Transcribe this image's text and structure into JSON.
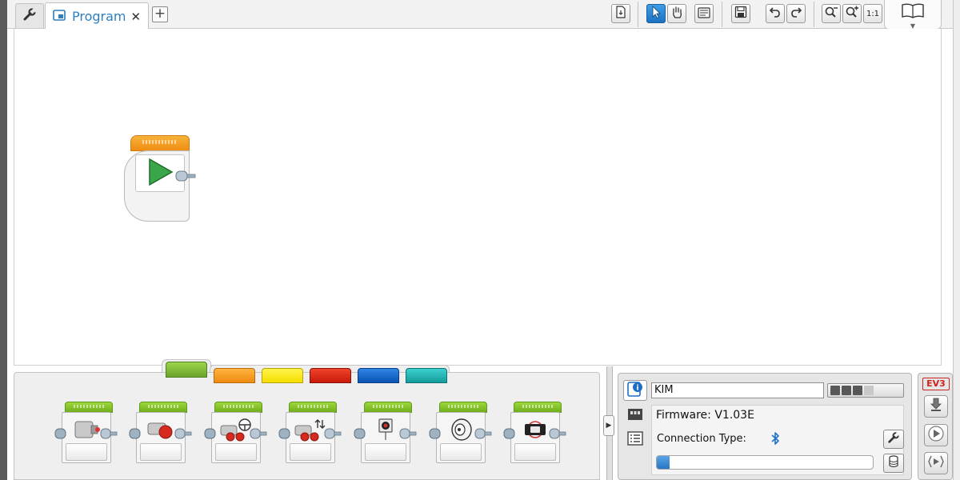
{
  "tabs": {
    "program_tab_label": "Program",
    "close_glyph": "✕",
    "add_glyph": "+"
  },
  "toolbar": {
    "icons": [
      "wrench-icon",
      "program-icon",
      "close-icon",
      "add-tab-icon",
      "download-file-icon",
      "select-arrow-icon",
      "pan-hand-icon",
      "comment-icon",
      "save-icon",
      "undo-icon",
      "redo-icon",
      "zoom-out-icon",
      "zoom-in-icon",
      "zoom-reset-icon",
      "book-icon"
    ],
    "zoom_reset_label": "1:1",
    "active_tool": "select"
  },
  "palette": {
    "tab_colors": [
      "#8cc63f",
      "#f7941d",
      "#ffe600",
      "#e4220e",
      "#0a5fc4",
      "#1bb4b4"
    ],
    "active_tab_index": 0,
    "blocks": [
      "medium-motor-block",
      "large-motor-block",
      "move-steering-block",
      "move-tank-block",
      "display-block",
      "sound-block",
      "brick-status-light-block"
    ]
  },
  "hardware": {
    "brick_name": "KIM",
    "battery_cells_on": 3,
    "battery_cells_total": 4,
    "firmware": "Firmware: V1.03E",
    "connection_label": "Connection Type:",
    "connection_type_icon": "bluetooth-icon",
    "progress": 0.06,
    "accent": "#1e6fc4"
  },
  "download": {
    "logo": "EV3"
  }
}
